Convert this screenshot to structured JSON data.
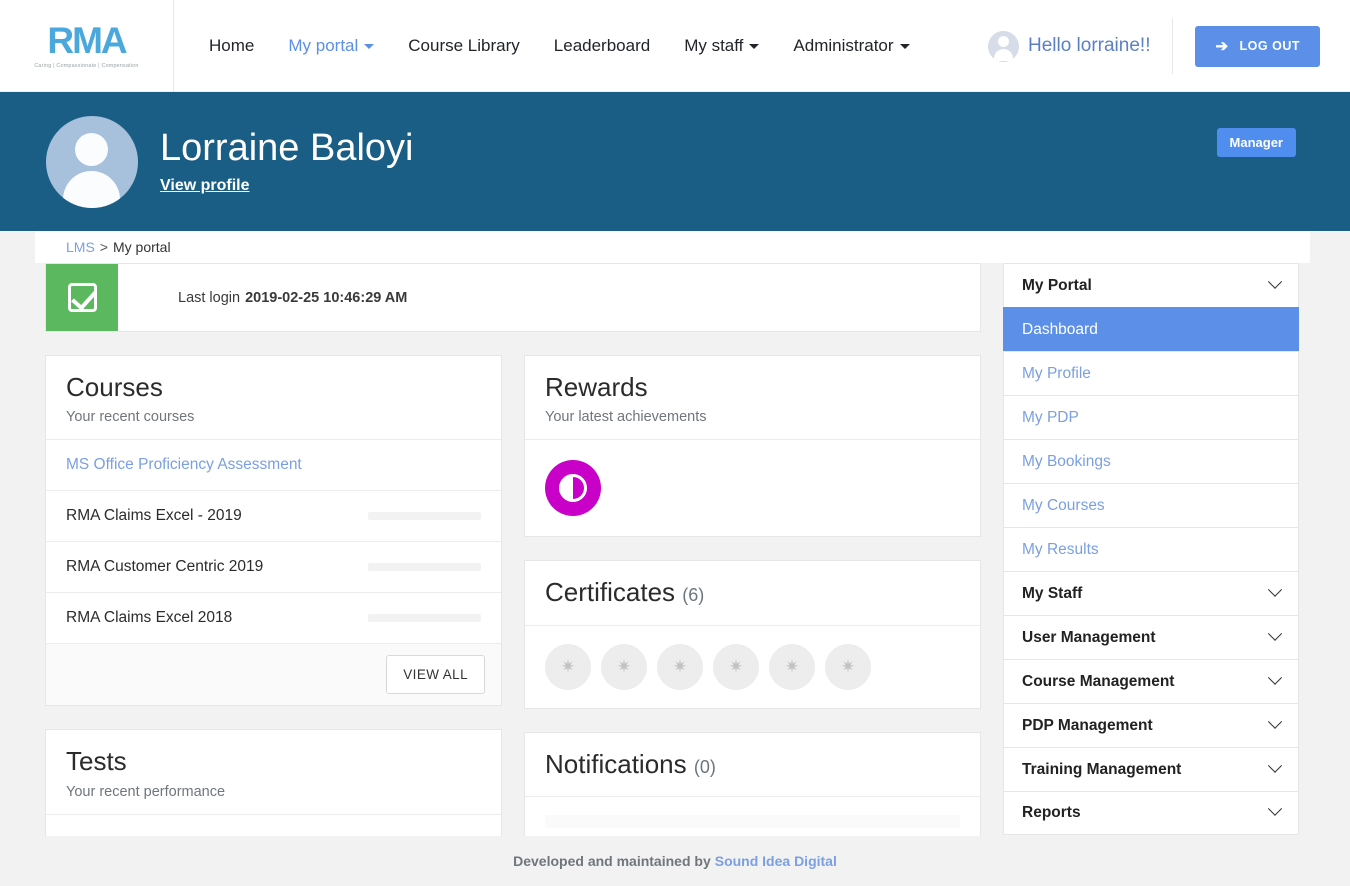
{
  "nav": {
    "brand": {
      "logo_text": "RMA",
      "tagline": "Caring | Compassionate | Compensation"
    },
    "items": [
      {
        "label": "Home",
        "active": false,
        "has_caret": false
      },
      {
        "label": "My portal",
        "active": true,
        "has_caret": true
      },
      {
        "label": "Course Library",
        "active": false,
        "has_caret": false
      },
      {
        "label": "Leaderboard",
        "active": false,
        "has_caret": false
      },
      {
        "label": "My staff",
        "active": false,
        "has_caret": true
      },
      {
        "label": "Administrator",
        "active": false,
        "has_caret": true
      }
    ],
    "greeting": "Hello lorraine!!",
    "logout_label": "LOG OUT",
    "logout_icon": "sign-out-icon"
  },
  "banner": {
    "name": "Lorraine Baloyi",
    "view_profile_label": "View profile",
    "role_badge": "Manager",
    "bg_color": "#1b5e85"
  },
  "breadcrumb": {
    "root": "LMS",
    "separator": ">",
    "current": "My portal"
  },
  "last_login": {
    "label": "Last login",
    "value": "2019-02-25 10:46:29 AM",
    "icon": "check-square-icon",
    "icon_color": "#5cb85f"
  },
  "courses": {
    "title": "Courses",
    "subtitle": "Your recent courses",
    "items": [
      {
        "name": "MS Office Proficiency Assessment",
        "is_link": true,
        "progress": null
      },
      {
        "name": "RMA Claims Excel - 2019",
        "is_link": false,
        "progress": 0
      },
      {
        "name": "RMA Customer Centric 2019",
        "is_link": false,
        "progress": 0
      },
      {
        "name": "RMA Claims Excel 2018",
        "is_link": false,
        "progress": 0
      }
    ],
    "view_all_label": "VIEW ALL"
  },
  "rewards": {
    "title": "Rewards",
    "subtitle": "Your latest achievements",
    "badges": [
      {
        "icon": "contrast-circle-icon",
        "color": "#c800c8"
      }
    ]
  },
  "certificates": {
    "title": "Certificates",
    "count": "(6)",
    "badges": [
      {
        "icon": "certificate-star-icon"
      },
      {
        "icon": "certificate-star-icon"
      },
      {
        "icon": "certificate-star-icon"
      },
      {
        "icon": "certificate-star-icon"
      },
      {
        "icon": "certificate-star-icon"
      },
      {
        "icon": "certificate-star-icon"
      }
    ]
  },
  "tests": {
    "title": "Tests",
    "subtitle": "Your recent performance"
  },
  "notifications": {
    "title": "Notifications",
    "count": "(0)"
  },
  "sidebar": {
    "sections": [
      {
        "label": "My Portal",
        "type": "section",
        "icon": "chevron-down-icon"
      },
      {
        "label": "Dashboard",
        "type": "item",
        "active": true
      },
      {
        "label": "My Profile",
        "type": "item",
        "active": false
      },
      {
        "label": "My PDP",
        "type": "item",
        "active": false
      },
      {
        "label": "My Bookings",
        "type": "item",
        "active": false
      },
      {
        "label": "My Courses",
        "type": "item",
        "active": false
      },
      {
        "label": "My Results",
        "type": "item",
        "active": false
      },
      {
        "label": "My Staff",
        "type": "section",
        "icon": "chevron-down-icon"
      },
      {
        "label": "User Management",
        "type": "section",
        "icon": "chevron-down-icon"
      },
      {
        "label": "Course Management",
        "type": "section",
        "icon": "chevron-down-icon"
      },
      {
        "label": "PDP Management",
        "type": "section",
        "icon": "chevron-down-icon"
      },
      {
        "label": "Training Management",
        "type": "section",
        "icon": "chevron-down-icon"
      },
      {
        "label": "Reports",
        "type": "section",
        "icon": "chevron-down-icon"
      }
    ]
  },
  "footer": {
    "text": "Developed and maintained by",
    "link": "Sound Idea Digital"
  },
  "colors": {
    "accent": "#5b8fe8",
    "banner": "#1b5e85",
    "success": "#5cb85f",
    "link": "#7b9fe0",
    "reward": "#c800c8"
  }
}
